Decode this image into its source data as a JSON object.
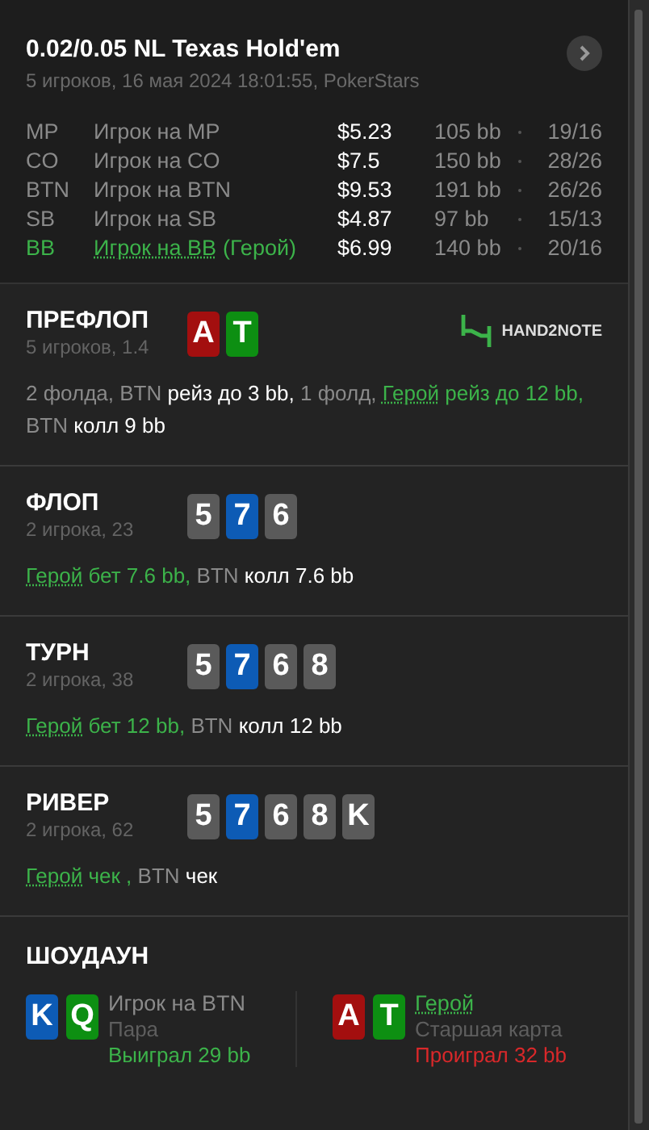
{
  "header": {
    "title": "0.02/0.05 NL Texas Hold'em",
    "subtitle": "5 игроков, 16 мая 2024 18:01:55, PokerStars"
  },
  "players": [
    {
      "position": "MP",
      "name": "Игрок на MP",
      "stack": "$5.23",
      "bb": "105 bb",
      "stats": "19/16",
      "hero": false
    },
    {
      "position": "CO",
      "name": "Игрок на CO",
      "stack": "$7.5",
      "bb": "150 bb",
      "stats": "28/26",
      "hero": false
    },
    {
      "position": "BTN",
      "name": "Игрок на BTN",
      "stack": "$9.53",
      "bb": "191 bb",
      "stats": "26/26",
      "hero": false
    },
    {
      "position": "SB",
      "name": "Игрок на SB",
      "stack": "$4.87",
      "bb": "97 bb",
      "stats": "15/13",
      "hero": false
    },
    {
      "position": "BB",
      "name": "Игрок на BB",
      "hero_tag": "(Герой)",
      "stack": "$6.99",
      "bb": "140 bb",
      "stats": "20/16",
      "hero": true
    }
  ],
  "streets": [
    {
      "name": "ПРЕФЛОП",
      "info": "5 игроков, 1.4",
      "logo": "HAND2NOTE",
      "cards": [
        {
          "rank": "A",
          "color": "#a30f0f"
        },
        {
          "rank": "T",
          "color": "#0d8f12"
        }
      ],
      "actions": [
        {
          "text": "2 фолда, BTN",
          "kind": "muted"
        },
        {
          "text": "рейз до 3 bb,",
          "kind": "action"
        },
        {
          "text": "1 фолд,",
          "kind": "muted"
        },
        {
          "text": "Герой",
          "kind": "hero"
        },
        {
          "text": "рейз до 12 bb,",
          "kind": "hero_action"
        },
        {
          "text": "BTN",
          "kind": "muted"
        },
        {
          "text": "колл 9 bb",
          "kind": "action"
        }
      ]
    },
    {
      "name": "ФЛОП",
      "info": "2 игрока, 23",
      "cards": [
        {
          "rank": "5",
          "color": "#5a5a5a"
        },
        {
          "rank": "7",
          "color": "#0d5bb5"
        },
        {
          "rank": "6",
          "color": "#5a5a5a"
        }
      ],
      "actions": [
        {
          "text": "Герой",
          "kind": "hero"
        },
        {
          "text": "бет 7.6 bb,",
          "kind": "hero_action"
        },
        {
          "text": "BTN",
          "kind": "muted"
        },
        {
          "text": "колл 7.6 bb",
          "kind": "action"
        }
      ]
    },
    {
      "name": "ТУРН",
      "info": "2 игрока, 38",
      "cards": [
        {
          "rank": "5",
          "color": "#5a5a5a"
        },
        {
          "rank": "7",
          "color": "#0d5bb5"
        },
        {
          "rank": "6",
          "color": "#5a5a5a"
        },
        {
          "rank": "8",
          "color": "#5a5a5a"
        }
      ],
      "actions": [
        {
          "text": "Герой",
          "kind": "hero"
        },
        {
          "text": "бет 12 bb,",
          "kind": "hero_action"
        },
        {
          "text": "BTN",
          "kind": "muted"
        },
        {
          "text": "колл 12 bb",
          "kind": "action"
        }
      ]
    },
    {
      "name": "РИВЕР",
      "info": "2 игрока, 62",
      "cards": [
        {
          "rank": "5",
          "color": "#5a5a5a"
        },
        {
          "rank": "7",
          "color": "#0d5bb5"
        },
        {
          "rank": "6",
          "color": "#5a5a5a"
        },
        {
          "rank": "8",
          "color": "#5a5a5a"
        },
        {
          "rank": "K",
          "color": "#5a5a5a"
        }
      ],
      "actions": [
        {
          "text": "Герой",
          "kind": "hero"
        },
        {
          "text": "чек ,",
          "kind": "hero_action"
        },
        {
          "text": "BTN",
          "kind": "muted"
        },
        {
          "text": "чек",
          "kind": "action"
        }
      ]
    }
  ],
  "showdown": {
    "title": "ШОУДАУН",
    "hands": [
      {
        "cards": [
          {
            "rank": "K",
            "color": "#0d5bb5"
          },
          {
            "rank": "Q",
            "color": "#0d8f12"
          }
        ],
        "player": "Игрок на BTN",
        "hero": false,
        "hand": "Пара",
        "result": "Выиграл 29 bb",
        "won": true
      },
      {
        "cards": [
          {
            "rank": "A",
            "color": "#a30f0f"
          },
          {
            "rank": "T",
            "color": "#0d8f12"
          }
        ],
        "player": "Герой",
        "hero": true,
        "hand": "Старшая карта",
        "result": "Проиграл 32 bb",
        "won": false
      }
    ]
  }
}
